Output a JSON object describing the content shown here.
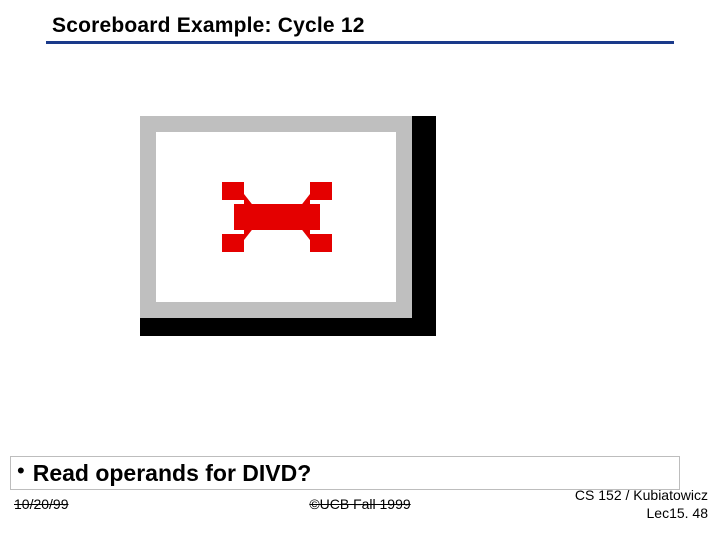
{
  "title": "Scoreboard Example: Cycle 12",
  "bullet": "Read operands for DIVD?",
  "footer": {
    "date": "10/20/99",
    "copyright": "©UCB Fall 1999",
    "course": "CS 152 / Kubiatowicz",
    "lecture": "Lec15. 48"
  },
  "icon": {
    "name": "broken-image-icon",
    "color": "#e40000"
  }
}
